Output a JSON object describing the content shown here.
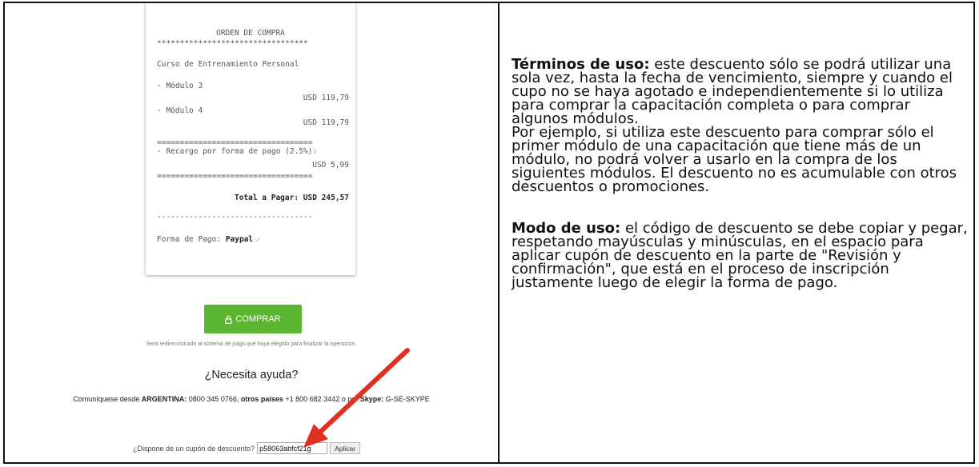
{
  "receipt": {
    "title": "ORDEN DE COMPRA",
    "stars": "*********************************",
    "course": "Curso de Entrenamiento Personal",
    "items": [
      {
        "name": "- Módulo 3",
        "price": "USD 119,79"
      },
      {
        "name": "- Módulo 4",
        "price": "USD 119,79"
      }
    ],
    "eq_line": "==================================",
    "surcharge_label": "- Recargo por forma de pago (2.5%):",
    "surcharge_price": "USD 5,99",
    "total_label": "Total a Pagar:",
    "total_value": "USD 245,57",
    "dash_line": "----------------------------------",
    "payment_label": "Forma de Pago:",
    "payment_value": "Paypal"
  },
  "buy_button": {
    "label": "COMPRAR",
    "icon": "lock-icon",
    "color": "#5cb531"
  },
  "redirect_text": "Será redireccionado al sistema de pago que haya elegido para finalizar la operación.",
  "help": {
    "heading": "¿Necesita ayuda?",
    "contact_prefix": "Comuníquese desde ",
    "country": "ARGENTINA:",
    "phone_ar": " 0800 345 0766, ",
    "others": "otros países",
    "phone_other": " +1 800 682 3442 o por ",
    "skype_label": "Skype:",
    "skype_value": " G-SE-SKYPE"
  },
  "coupon": {
    "question": "¿Dispone de un cupón de descuento?",
    "code": "p58063abfcf21g",
    "apply_label": "Aplicar"
  },
  "annotation": {
    "arrow_color": "#e03021"
  },
  "terms": {
    "heading": "Términos de uso:",
    "text1": " este descuento sólo se podrá utilizar una sola vez, hasta la fecha de vencimiento, siempre y cuando el cupo no se haya agotado e independientemente si lo utiliza para comprar la capacitación completa o para comprar algunos módulos.",
    "text2": "Por ejemplo, si utiliza este descuento para comprar sólo el primer módulo de una capacitación que tiene más de un módulo, no podrá volver a usarlo en la compra de los siguientes módulos. El descuento no es acumulable con otros descuentos o promociones."
  },
  "usage": {
    "heading": "Modo de uso:",
    "text": " el código de descuento se debe copiar y pegar, respetando mayúsculas y minúsculas, en el espacio para aplicar cupón de descuento en la parte de \"Revisión y confirmación\", que está en el proceso de inscripción justamente luego de elegir la forma de pago."
  }
}
